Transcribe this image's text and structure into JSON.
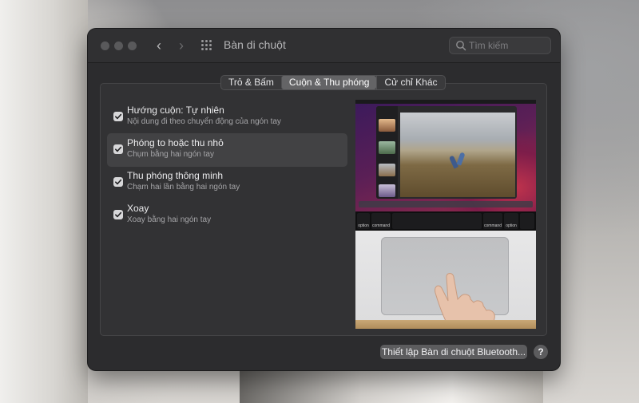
{
  "window": {
    "title": "Bàn di chuột",
    "search_placeholder": "Tìm kiếm"
  },
  "tabs": [
    {
      "label": "Trỏ & Bấm",
      "active": false
    },
    {
      "label": "Cuộn & Thu phóng",
      "active": true
    },
    {
      "label": "Cử chỉ Khác",
      "active": false
    }
  ],
  "options": [
    {
      "title": "Hướng cuộn: Tự nhiên",
      "description": "Nội dung đi theo chuyển động của ngón tay",
      "checked": true
    },
    {
      "title": "Phóng to hoặc thu nhỏ",
      "description": "Chụm bằng hai ngón tay",
      "checked": true,
      "selected": true
    },
    {
      "title": "Thu phóng thông minh",
      "description": "Chạm hai lần bằng hai ngón tay",
      "checked": true
    },
    {
      "title": "Xoay",
      "description": "Xoay bằng hai ngón tay",
      "checked": true
    }
  ],
  "preview": {
    "key_labels": [
      "option",
      "command",
      "command",
      "option"
    ]
  },
  "footer": {
    "bluetooth_button": "Thiết lập Bàn di chuột Bluetooth...",
    "help_label": "?"
  },
  "colors": {
    "window_bg": "#2c2c2e",
    "checkbox": "#d7d7d9",
    "selected_row": "#424244"
  }
}
